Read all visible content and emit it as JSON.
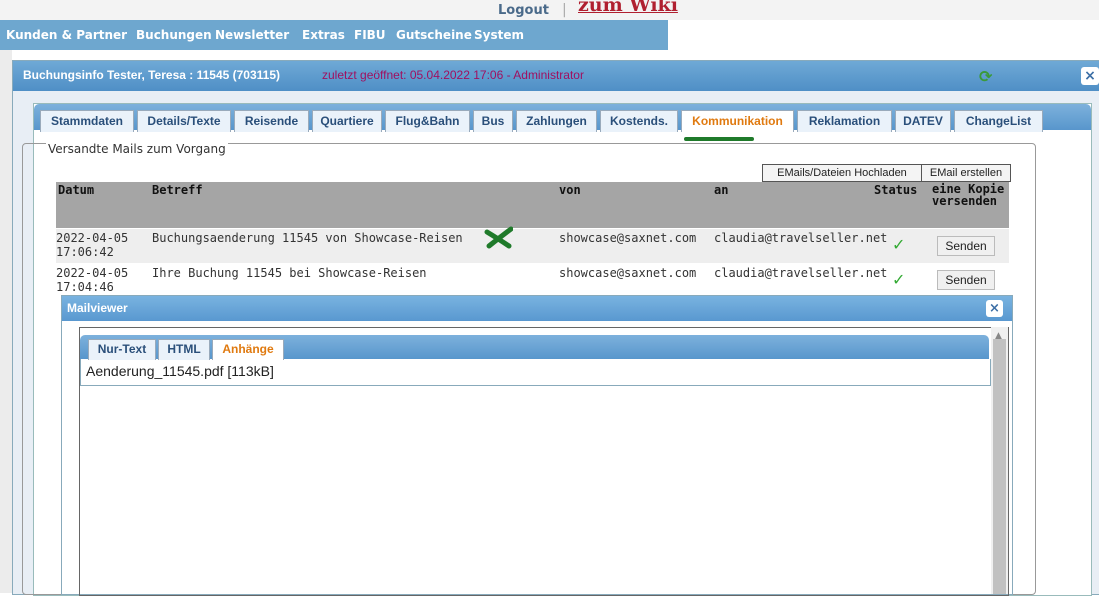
{
  "top": {
    "logout": "Logout",
    "separator": "|",
    "wiki": "zum Wiki"
  },
  "mainnav": [
    "Kunden & Partner",
    "Buchungen",
    "Newsletter",
    "Extras",
    "FIBU",
    "Gutscheine",
    "System"
  ],
  "dialog": {
    "title": "Buchungsinfo Tester, Teresa : 11545 (703115)",
    "subtitle": "zuletzt geöffnet: 05.04.2022 17:06 - Administrator",
    "close": "×",
    "refresh_icon": "refresh-icon"
  },
  "tabs": [
    {
      "label": "Stammdaten"
    },
    {
      "label": "Details/Texte"
    },
    {
      "label": "Reisende"
    },
    {
      "label": "Quartiere"
    },
    {
      "label": "Flug&Bahn"
    },
    {
      "label": "Bus"
    },
    {
      "label": "Zahlungen"
    },
    {
      "label": "Kostends."
    },
    {
      "label": "Kommunikation",
      "active": true
    },
    {
      "label": "Reklamation"
    },
    {
      "label": "DATEV"
    },
    {
      "label": "ChangeList"
    }
  ],
  "mails": {
    "legend": "Versandte Mails zum Vorgang",
    "upload_btn": "EMails/Dateien Hochladen",
    "create_btn": "EMail erstellen",
    "columns": {
      "datum": "Datum",
      "betreff": "Betreff",
      "von": "von",
      "an": "an",
      "status": "Status",
      "kopie": "eine Kopie versenden"
    },
    "rows": [
      {
        "datum": "2022-04-05 17:06:42",
        "betreff": "Buchungsaenderung 11545 von Showcase-Reisen",
        "von": "showcase@saxnet.com",
        "an": "claudia@travelseller.net",
        "status": "✓",
        "action": "Senden"
      },
      {
        "datum": "2022-04-05 17:04:46",
        "betreff": "Ihre Buchung 11545 bei Showcase-Reisen",
        "von": "showcase@saxnet.com",
        "an": "claudia@travelseller.net",
        "status": "✓",
        "action": "Senden"
      }
    ]
  },
  "mailviewer": {
    "title": "Mailviewer",
    "close": "×",
    "tabs": [
      {
        "label": "Nur-Text"
      },
      {
        "label": "HTML"
      },
      {
        "label": "Anhänge",
        "active": true
      }
    ],
    "attachment": "Aenderung_11545.pdf [113kB]"
  },
  "colors": {
    "nav_blue": "#6ea7cf",
    "active_tab": "#e07a10",
    "accent_green": "#1f7a2a",
    "check_green": "#33aa33"
  }
}
